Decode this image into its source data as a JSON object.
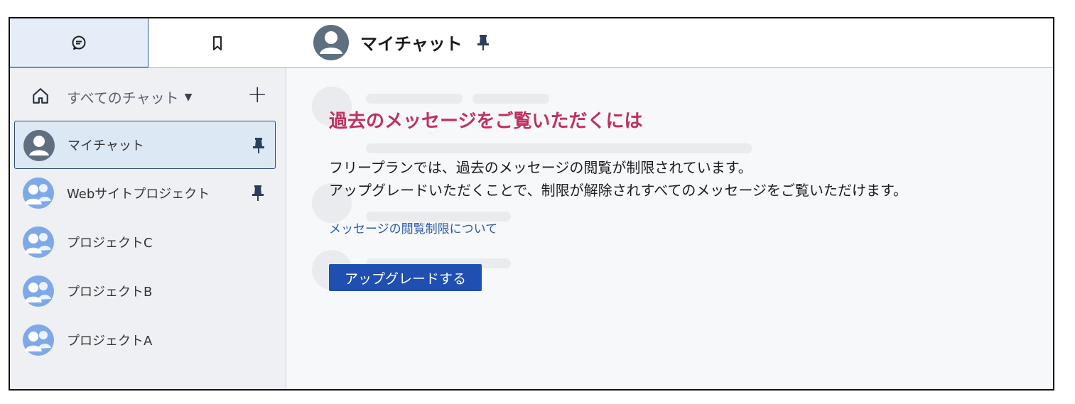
{
  "tabs": [
    {
      "icon": "chat-bubble-icon",
      "active": true
    },
    {
      "icon": "bookmark-icon",
      "active": false
    }
  ],
  "sidebar": {
    "filter_label": "すべてのチャット",
    "filter_caret": "▼",
    "add_label": "+",
    "items": [
      {
        "label": "マイチャット",
        "pinned": true,
        "selected": true,
        "avatar": "person-avatar-icon"
      },
      {
        "label": "Webサイトプロジェクト",
        "pinned": true,
        "selected": false,
        "avatar": "group-avatar-icon"
      },
      {
        "label": "プロジェクトC",
        "pinned": false,
        "selected": false,
        "avatar": "group-avatar-icon"
      },
      {
        "label": "プロジェクトB",
        "pinned": false,
        "selected": false,
        "avatar": "group-avatar-icon"
      },
      {
        "label": "プロジェクトA",
        "pinned": false,
        "selected": false,
        "avatar": "group-avatar-icon"
      }
    ]
  },
  "header": {
    "title": "マイチャット",
    "pinned": true
  },
  "notice": {
    "title": "過去のメッセージをご覧いただくには",
    "line1": "フリープランでは、過去のメッセージの閲覧が制限されています。",
    "line2": "アップグレードいただくことで、制限が解除されすべてのメッセージをご覧いただけます。",
    "link_label": "メッセージの閲覧制限について",
    "button_label": "アップグレードする"
  },
  "colors": {
    "accent": "#1f4fb0",
    "title": "#c0305f",
    "link": "#2d5aa8",
    "selected_bg": "#dde8f5",
    "sidebar_bg": "#eef0f3"
  }
}
